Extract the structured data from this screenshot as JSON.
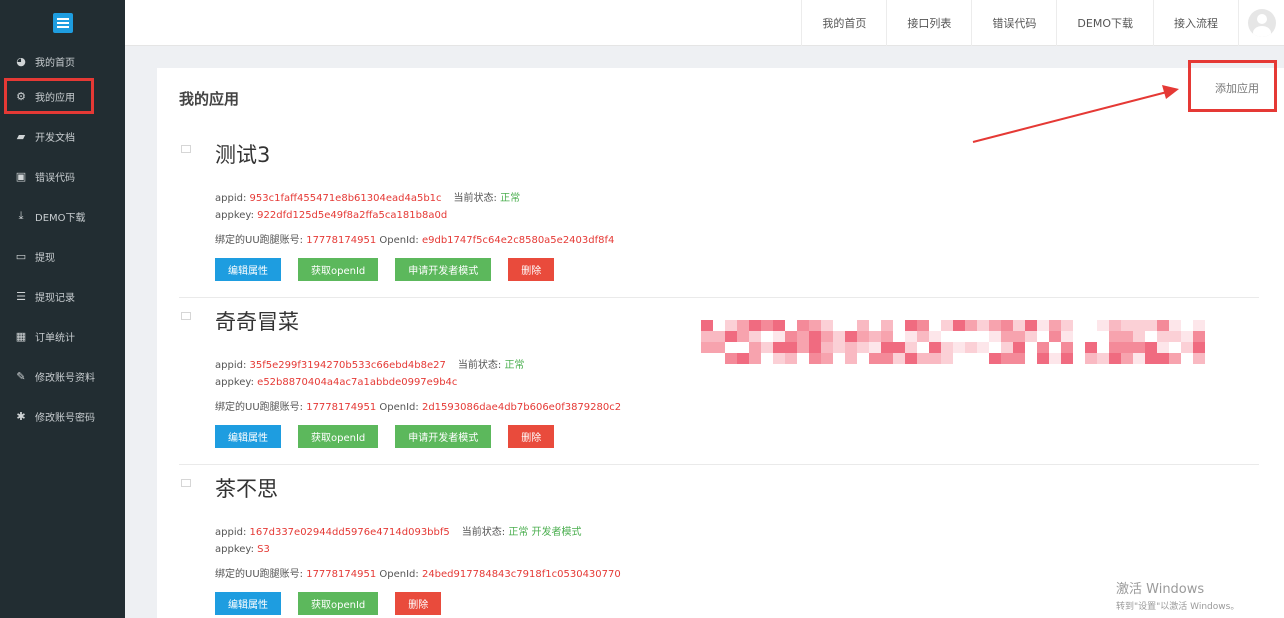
{
  "sidebar": {
    "items": [
      {
        "label": "我的首页",
        "icon": "dashboard-icon",
        "glyph": "◕"
      },
      {
        "label": "我的应用",
        "icon": "gears-icon",
        "glyph": "⚙"
      },
      {
        "label": "开发文档",
        "icon": "book-icon",
        "glyph": "▰"
      },
      {
        "label": "错误代码",
        "icon": "file-chart-icon",
        "glyph": "▣"
      },
      {
        "label": "DEMO下载",
        "icon": "download-icon",
        "glyph": "⤓"
      },
      {
        "label": "提现",
        "icon": "credit-card-icon",
        "glyph": "▭"
      },
      {
        "label": "提现记录",
        "icon": "list-icon",
        "glyph": "☰"
      },
      {
        "label": "订单统计",
        "icon": "grid-icon",
        "glyph": "▦"
      },
      {
        "label": "修改账号资料",
        "icon": "pencil-icon",
        "glyph": "✎"
      },
      {
        "label": "修改账号密码",
        "icon": "cog-icon",
        "glyph": "✱"
      }
    ],
    "active_index": 1
  },
  "topnav": [
    "我的首页",
    "接口列表",
    "错误代码",
    "DEMO下载",
    "接入流程"
  ],
  "page": {
    "title": "我的应用",
    "add_label": "添加应用"
  },
  "labels": {
    "appid": "appid:",
    "status": "当前状态:",
    "appkey": "appkey:",
    "uu_account": "绑定的UU跑腿账号:",
    "openid": "OpenId:"
  },
  "apps": [
    {
      "name": "测试3",
      "appid": "953c1faff455471e8b61304ead4a5b1c",
      "status": "正常",
      "appkey": "922dfd125d5e49f8a2ffa5ca181b8a0d",
      "uu_account": "17778174951",
      "openid": "e9db1747f5c64e2c8580a5e2403df8f4",
      "buttons": [
        "编辑属性",
        "获取openId",
        "申请开发者模式",
        "删除"
      ]
    },
    {
      "name": "奇奇冒菜",
      "appid": "35f5e299f3194270b533c66ebd4b8e27",
      "status": "正常",
      "appkey": "e52b8870404a4ac7a1abbde0997e9b4c",
      "uu_account": "17778174951",
      "openid": "2d1593086dae4db7b606e0f3879280c2",
      "buttons": [
        "编辑属性",
        "获取openId",
        "申请开发者模式",
        "删除"
      ]
    },
    {
      "name": "茶不思",
      "appid": "167d337e02944dd5976e4714d093bbf5",
      "status": "正常 开发者模式",
      "appkey": "S3",
      "uu_account": "17778174951",
      "openid": "24bed917784843c7918f1c0530430770",
      "buttons": [
        "编辑属性",
        "获取openId",
        "删除"
      ]
    }
  ],
  "watermark": {
    "line1": "激活 Windows",
    "line2": "转到\"设置\"以激活 Windows。"
  },
  "colors": {
    "sidebar": "#222d32",
    "primary": "#1e9de0",
    "success": "#5cb85c",
    "danger": "#e94b3c",
    "highlight": "#e53935"
  }
}
